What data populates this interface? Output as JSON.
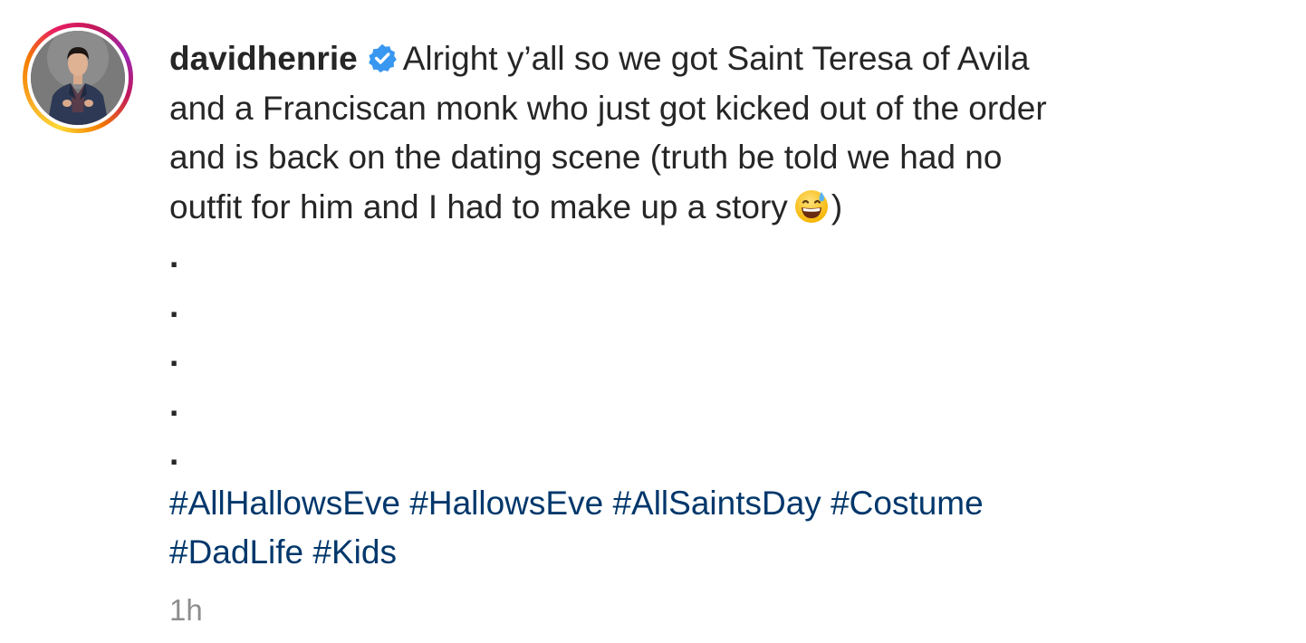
{
  "post": {
    "username": "davidhenrie",
    "verified": true,
    "verified_icon": "verified-badge-icon",
    "avatar_icon": "profile-avatar",
    "caption_lines": [
      "Alright y’all so we got Saint Teresa of Avila",
      "and a Franciscan monk who just got kicked out of the order",
      "and is back on the dating scene (truth be told we had no",
      "outfit for him and I had to make up a story",
      ")"
    ],
    "emoji": "grinning-face-with-sweat-emoji",
    "dots": [
      ".",
      ".",
      ".",
      ".",
      "."
    ],
    "hashtags": [
      "#AllHallowsEve",
      "#HallowsEve",
      "#AllSaintsDay",
      "#Costume",
      "#DadLife",
      "#Kids"
    ],
    "timestamp": "1h"
  },
  "colors": {
    "text": "#262626",
    "hashtag": "#00376b",
    "timestamp": "#8e8e8e",
    "verified": "#3897f0"
  }
}
